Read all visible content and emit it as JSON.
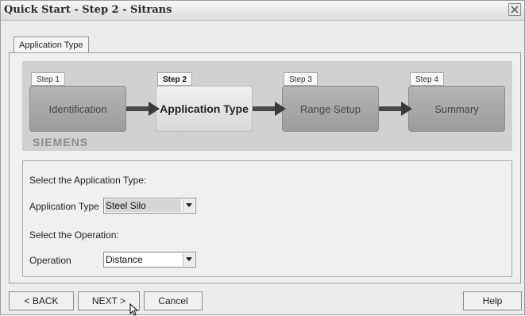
{
  "window": {
    "title": "Quick Start - Step 2 - Sitrans"
  },
  "tabs": [
    {
      "label": "Application Type"
    }
  ],
  "steps": [
    {
      "step_label": "Step 1",
      "name": "Identification"
    },
    {
      "step_label": "Step 2",
      "name": "Application Type"
    },
    {
      "step_label": "Step 3",
      "name": "Range Setup"
    },
    {
      "step_label": "Step 4",
      "name": "Summary"
    }
  ],
  "current_step": 2,
  "brand": "SIEMENS",
  "form": {
    "app_type_prompt": "Select the Application Type:",
    "app_type_label": "Application Type",
    "app_type_value": "Steel Silo",
    "operation_prompt": "Select the Operation:",
    "operation_label": "Operation",
    "operation_value": "Distance"
  },
  "buttons": {
    "back": "< BACK",
    "next": "NEXT >",
    "cancel": "Cancel",
    "help": "Help"
  },
  "icons": {
    "close": "close-icon",
    "step_arrow": "right-arrow-icon",
    "dropdown": "chevron-down-icon",
    "cursor": "mouse-pointer-icon"
  }
}
